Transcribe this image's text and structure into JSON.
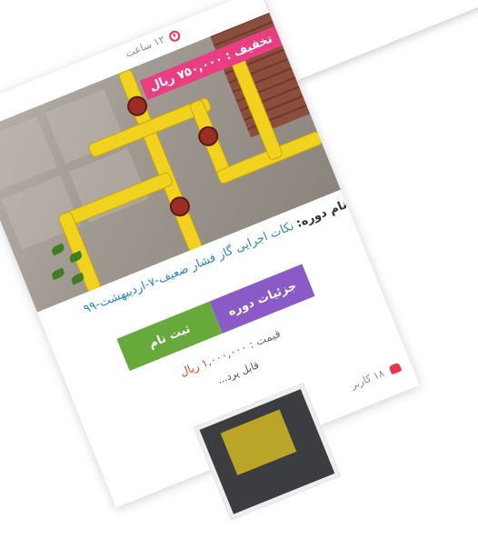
{
  "card": {
    "time": "۱۲ ساعت",
    "discount": "تخفیف : ۷۵۰,۰۰۰ ریال",
    "name_label": "نام دوره:",
    "name_link": "نکات اجرایی گاز فشار ضعیف-۷-اردیبهشت-۹۹",
    "details_button": "جزئیات دوره",
    "register_button": "ثبت نام",
    "price_label": "قیمت :",
    "price_value": "۱,۰۰۰,۰۰۰ ریال",
    "payable": "قابل پرد...",
    "users": "۱۸ کاربر"
  },
  "colors": {
    "details": "#8a5bc6",
    "register": "#67a93a",
    "discount": "#e93f82",
    "link": "#2b86c5",
    "price": "#d9452e"
  },
  "icons": [
    "clock-icon",
    "users-icon"
  ]
}
